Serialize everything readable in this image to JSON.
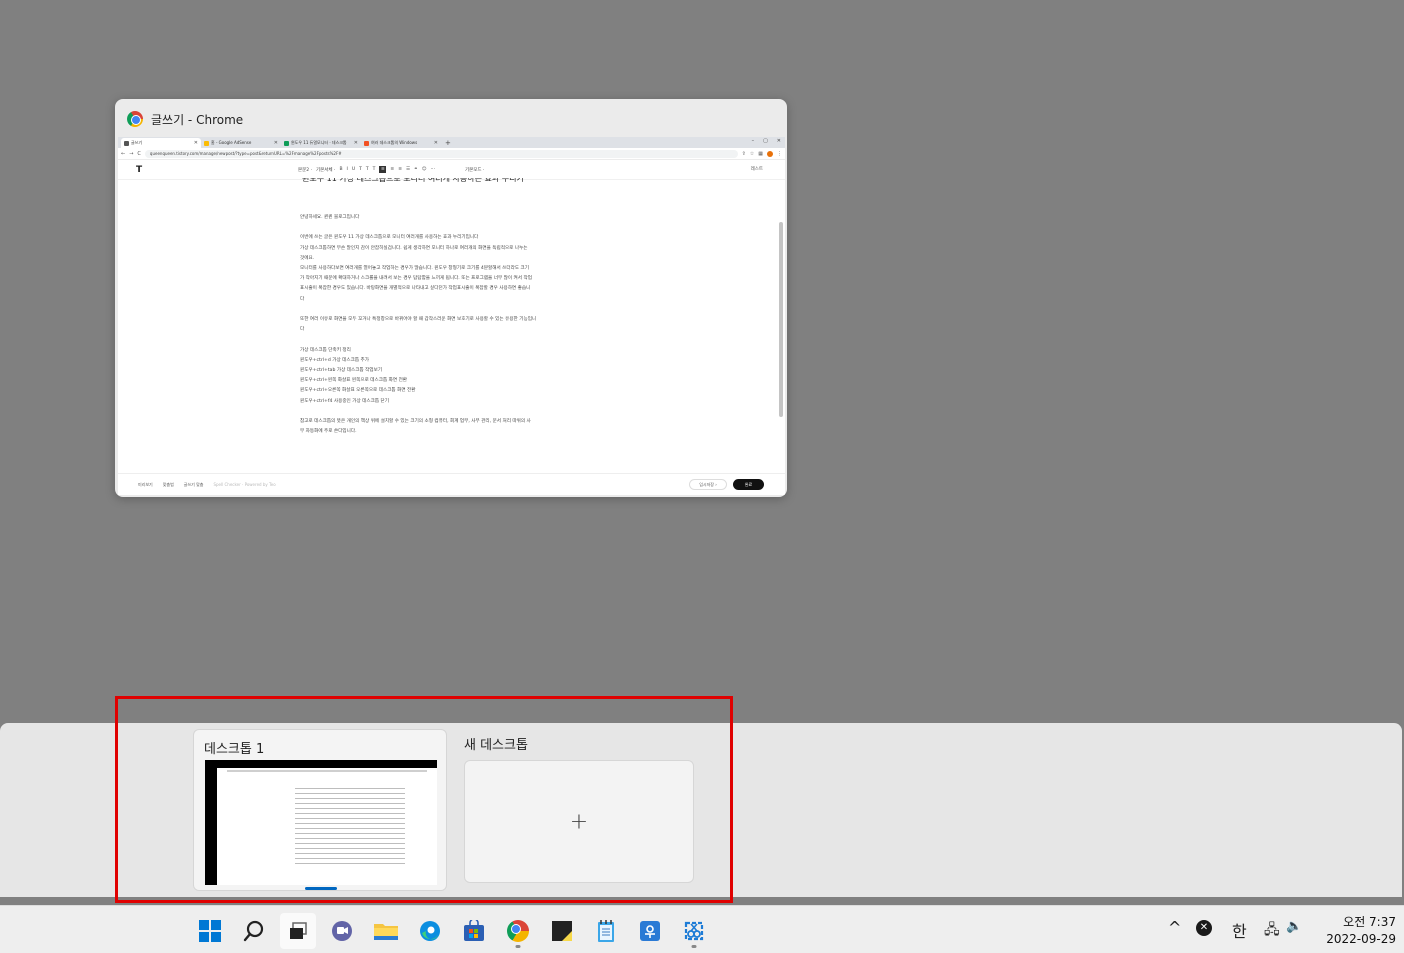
{
  "window_preview": {
    "title": "글쓰기 - Chrome",
    "browser": {
      "tabs": [
        {
          "label": "글쓰기",
          "active": true,
          "color": "#555555"
        },
        {
          "label": "홈 - Google AdSense",
          "active": false,
          "color": "#fbbc04"
        },
        {
          "label": "윈도우 11 듀얼모니터 · 데스크톱",
          "active": false,
          "color": "#0f9d58"
        },
        {
          "label": "여러 데스크톱의 Windows",
          "active": false,
          "color": "#f25022"
        }
      ],
      "new_tab": "+",
      "window_buttons": {
        "min": "–",
        "max": "▢",
        "close": "✕"
      },
      "nav": {
        "back": "←",
        "forward": "→",
        "reload": "C"
      },
      "url": "queenqueen.tistory.com/manage/newpost/?type=post&returnURL=%2Fmanage%2Fposts%2F#"
    },
    "editor": {
      "logo": "T",
      "toolbar": [
        "본문2 ·",
        "기본서체 ·",
        "B",
        "I",
        "U",
        "T",
        "T",
        "T"
      ],
      "toolbar_right": "기본모드 ·",
      "top_right": "레스트",
      "headline": "윈도우 11 가상 데스크톱으로 모니터 여러개 사용하는 효과 누리기",
      "paragraphs": [
        "안녕하세요. 퀸퀸 블로그입니다",
        "",
        "이번에 쓰는 글은 윈도우 11 가상 데스크톱으로 모니터 여러개를 사용하는 효과 누리기입니다",
        "가상 데스크톱하면 무슨 말인지 감이 안잡히실겁니다. 쉽게 생각하면 모니터 하나로 여러개의 화면을 독립적으로 나누는",
        "것에요.",
        "모니터를 사용하다보면 여러개를 열어놓고 작업하는 경우가 많습니다. 윈도우 창형기로 크기를 4분할해서 쓰더라도 크기",
        "가 작아지기 때문에 확대하거나 스크롤을 내려서 보는 경우 답답함을 느끼게 됩니다. 또는 프로그램을 너무 많이 켜서 작업",
        "표시줄이 복잡한 경우도 있습니다. 바탕화면을 개별적으로 나타내고 싶다던가 작업표시줄이 복잡할 경우 사용하면 좋습니",
        "다",
        "",
        "또한 여러 이유로 화면을 모두 꼬거나 특정창으로 바뀌어야 할 때 갑작스러운 화면 보호기로 사용할 수 있는 유용한 기능입니",
        "다",
        "",
        "가상 데스크톱 단축키 정리",
        "윈도우+ctrl+d 가상 데스크톱 추가",
        "윈도우+ctrl+tab 가상 데스크톱 작업보기",
        "윈도우+ctrl+왼쪽 화살표 왼쪽으로 데스크톱 화면 전환",
        "윈도우+ctrl+오른쪽 화살표 오른쪽으로 데스크톱 화면 전환",
        "윈도우+ctrl+f4 사용중인 가상 데스크톱 닫기",
        "",
        "참고로 데스크톱의 뜻은 개인의 책상 위에 설치할 수 있는 크기의 소형 컴퓨터, 회계 업무, 사무 관리, 문서 처리 따위의 사",
        "무 자동화에 주로 쓴다입니다."
      ],
      "footer": {
        "left": [
          "미리보기",
          "맞춤법",
          "글쓰기 맞춤"
        ],
        "dim": "Spell Checker · Powered by Teo",
        "draft": "임시저장 ›",
        "done": "완료"
      }
    }
  },
  "desktops": {
    "desktop1_label": "데스크톱 1",
    "new_desktop_label": "새 데스크톱",
    "new_desktop_symbol": "+"
  },
  "taskbar": {
    "tray": {
      "chevron": "^",
      "status": "✕",
      "ime": "한",
      "network": "🖧",
      "volume": "🔈"
    },
    "clock": {
      "time": "오전 7:37",
      "date": "2022-09-29"
    }
  },
  "colors": {
    "accent": "#0078d4",
    "highlight": "#e00000",
    "desk_indicator": "#0067c0"
  }
}
